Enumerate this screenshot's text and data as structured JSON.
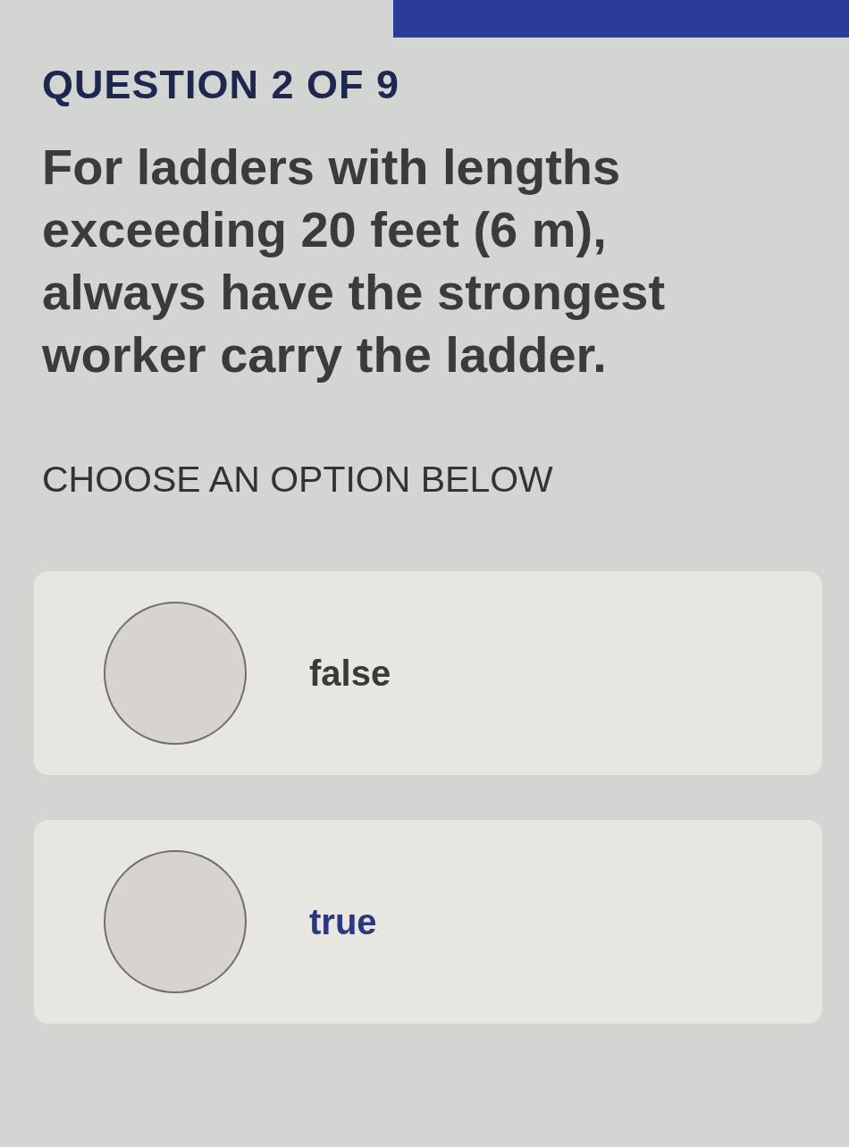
{
  "header": {
    "progress": "QUESTION 2 OF 9"
  },
  "question": {
    "text": "For ladders with lengths exceeding 20 feet (6 m), always have the strongest worker carry the ladder."
  },
  "prompt": "CHOOSE AN OPTION BELOW",
  "options": [
    {
      "label": "false",
      "selected": false,
      "highlighted": false
    },
    {
      "label": "true",
      "selected": false,
      "highlighted": true
    }
  ]
}
